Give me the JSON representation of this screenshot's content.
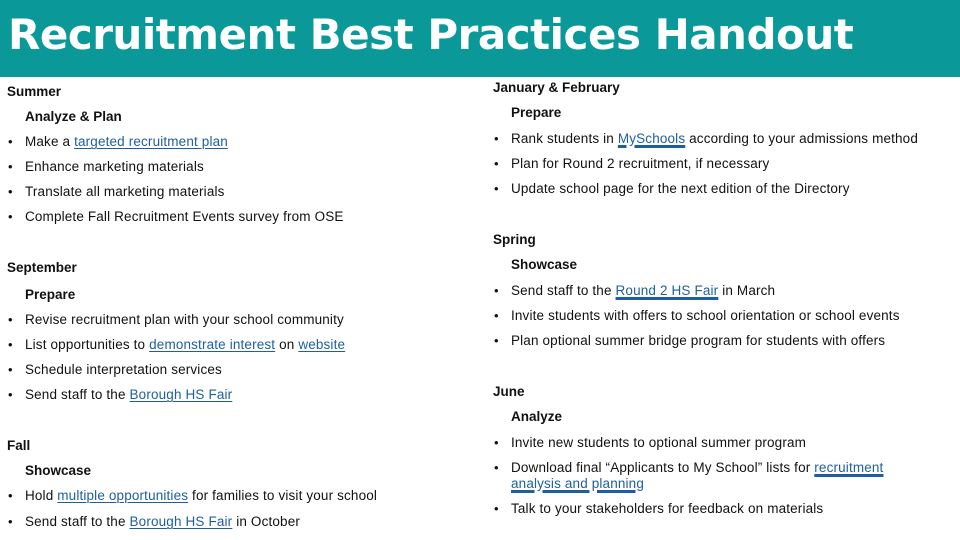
{
  "title": "Recruitment Best Practices Handout",
  "colors": {
    "header_bg": "#0a9898",
    "title_text": "#ffffff",
    "link": "#1f5fa0",
    "body_text": "#111111"
  },
  "bullet_icon": "•",
  "left": {
    "summer": {
      "heading": "Summer",
      "phase": "Analyze & Plan",
      "items": [
        {
          "pre": "Make a ",
          "link": "targeted recruitment plan",
          "post": ""
        },
        {
          "text": "Enhance marketing materials"
        },
        {
          "text": "Translate all marketing materials"
        },
        {
          "text": "Complete Fall Recruitment Events survey from OSE"
        }
      ]
    },
    "september": {
      "heading": "September",
      "phase": "Prepare",
      "items": [
        {
          "text": "Revise recruitment plan with your school community"
        },
        {
          "pre": "List opportunities to ",
          "link": "demonstrate interest",
          "mid": " on ",
          "link2": "website"
        },
        {
          "text": "Schedule interpretation services"
        },
        {
          "pre": "Send staff to the ",
          "link": "Borough HS Fair",
          "post": ""
        }
      ]
    },
    "fall": {
      "heading": "Fall",
      "phase": "Showcase",
      "items": [
        {
          "pre": "Hold ",
          "link": "multiple opportunities",
          "post": " for families to visit your school"
        },
        {
          "pre": "Send staff to the ",
          "link": "Borough HS Fair",
          "post": " in October"
        }
      ]
    }
  },
  "right": {
    "janfeb": {
      "heading": "January & February",
      "phase": "Prepare",
      "items": [
        {
          "pre": "Rank students in ",
          "link": "MySchools",
          "post": " according to your admissions method"
        },
        {
          "text": "Plan for Round 2 recruitment, if necessary"
        },
        {
          "text": "Update school page for the next edition of the Directory"
        }
      ]
    },
    "spring": {
      "heading": "Spring",
      "phase": "Showcase",
      "items": [
        {
          "pre": "Send staff to the ",
          "link": "Round 2 HS Fair",
          "post": " in March"
        },
        {
          "text": "Invite students with offers to school orientation or school events"
        },
        {
          "text": "Plan optional summer bridge program for students with offers"
        }
      ]
    },
    "june": {
      "heading": "June",
      "phase": "Analyze",
      "items": [
        {
          "text": "Invite new students to optional summer program"
        },
        {
          "pre": "Download final “Applicants to My School” lists for ",
          "link": "recruitment analysis and planning",
          "post": ""
        },
        {
          "text": "Talk to your stakeholders for feedback on materials"
        }
      ]
    }
  }
}
